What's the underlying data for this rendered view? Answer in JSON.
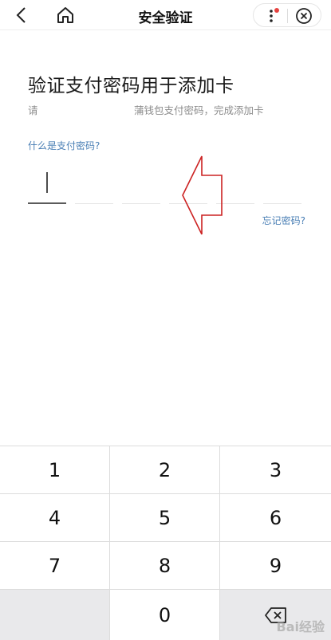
{
  "header": {
    "title": "安全验证",
    "icons": {
      "back": "back-arrow-icon",
      "home": "home-icon",
      "more": "more-vertical-icon",
      "close": "close-circle-icon"
    },
    "notification_dot_color": "#e64340"
  },
  "content": {
    "heading": "验证支付密码用于添加卡",
    "subtitle_start": "请",
    "subtitle_end": "蒲钱包支付密码，完成添加卡",
    "link_what": "什么是支付密码?",
    "link_forgot": "忘记密码?",
    "password_length": 6,
    "accent_color": "#4a7fb5",
    "annotation_arrow_color": "#cc2222"
  },
  "keypad": {
    "keys": [
      "1",
      "2",
      "3",
      "4",
      "5",
      "6",
      "7",
      "8",
      "9",
      "",
      "0",
      ""
    ],
    "icons": {
      "delete": "backspace-icon"
    }
  },
  "watermark": {
    "text": "Bai经验"
  }
}
